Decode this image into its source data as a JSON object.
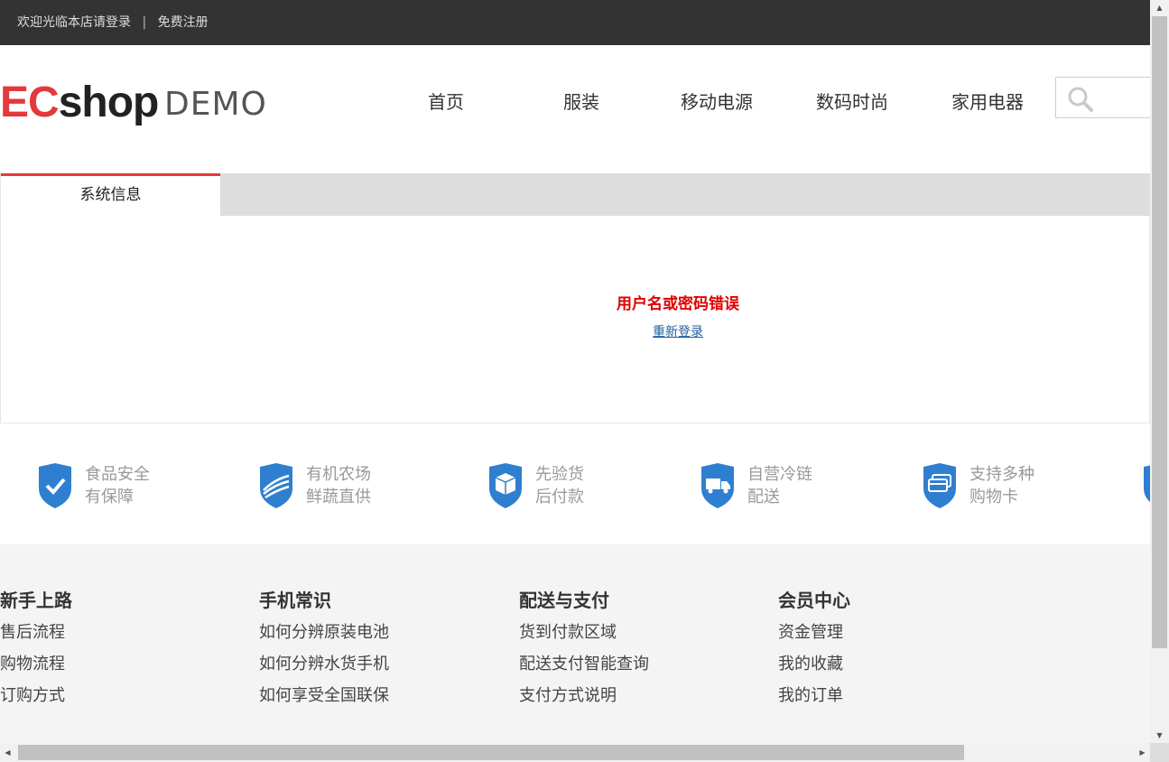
{
  "topbar": {
    "welcome": "欢迎光临本店请登录",
    "separator": "|",
    "register": "免费注册"
  },
  "logo": {
    "brand_red": "EC",
    "brand_dark": "shop",
    "demo": "DEMO"
  },
  "nav": [
    "首页",
    "服装",
    "移动电源",
    "数码时尚",
    "家用电器"
  ],
  "search": {
    "icon": "search-icon"
  },
  "panel": {
    "tab": "系统信息",
    "error": "用户名或密码错误",
    "relogin": "重新登录"
  },
  "features": [
    {
      "line1": "食品安全",
      "line2": "有保障",
      "icon": "check-shield-icon"
    },
    {
      "line1": "有机农场",
      "line2": "鲜蔬直供",
      "icon": "farm-shield-icon"
    },
    {
      "line1": "先验货",
      "line2": "后付款",
      "icon": "box-shield-icon"
    },
    {
      "line1": "自营冷链",
      "line2": "配送",
      "icon": "truck-shield-icon"
    },
    {
      "line1": "支持多种",
      "line2": "购物卡",
      "icon": "card-shield-icon"
    }
  ],
  "footer": [
    {
      "title": "新手上路",
      "links": [
        "售后流程",
        "购物流程",
        "订购方式"
      ]
    },
    {
      "title": "手机常识",
      "links": [
        "如何分辨原装电池",
        "如何分辨水货手机",
        "如何享受全国联保"
      ]
    },
    {
      "title": "配送与支付",
      "links": [
        "货到付款区域",
        "配送支付智能查询",
        "支付方式说明"
      ]
    },
    {
      "title": "会员中心",
      "links": [
        "资金管理",
        "我的收藏",
        "我的订单"
      ]
    }
  ],
  "colors": {
    "accent": "#e4393c",
    "error": "#e00000",
    "link": "#1f5f9f",
    "shield": "#2f7fd0",
    "topbar": "#333333"
  }
}
